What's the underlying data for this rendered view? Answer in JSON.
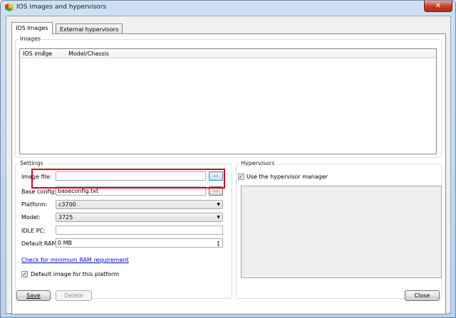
{
  "window": {
    "title": "IOS images and hypervisors",
    "close_glyph": "✕"
  },
  "tabs": [
    {
      "label": "IOS Images",
      "active": true
    },
    {
      "label": "External hypervisors",
      "active": false
    }
  ],
  "images": {
    "group_title": "Images",
    "columns": [
      "IOS image",
      "Model/Chassis"
    ],
    "rows": []
  },
  "settings": {
    "group_title": "Settings",
    "image_file": {
      "label": "Image file:",
      "value": "",
      "browse_label": "..."
    },
    "base_config": {
      "label": "Base config:",
      "value": "baseconfig.txt",
      "browse_label": "..."
    },
    "platform": {
      "label": "Platform:",
      "value": "c3700"
    },
    "model": {
      "label": "Model:",
      "value": "3725"
    },
    "idle_pc": {
      "label": "IDLE PC:",
      "value": ""
    },
    "default_ram": {
      "label": "Default RAM:",
      "value": "0 MB"
    },
    "ram_link": "Check for minimum RAM requirement",
    "default_image": {
      "label": "Default image for this platform",
      "checked": true
    }
  },
  "hypervisors": {
    "group_title": "Hypervisors",
    "use_manager": {
      "label": "Use the hypervisor manager",
      "checked": true
    }
  },
  "buttons": {
    "save": "Save",
    "delete": "Delete",
    "close": "Close"
  },
  "colors": {
    "highlight": "#d0091f",
    "link": "#0000ee"
  }
}
